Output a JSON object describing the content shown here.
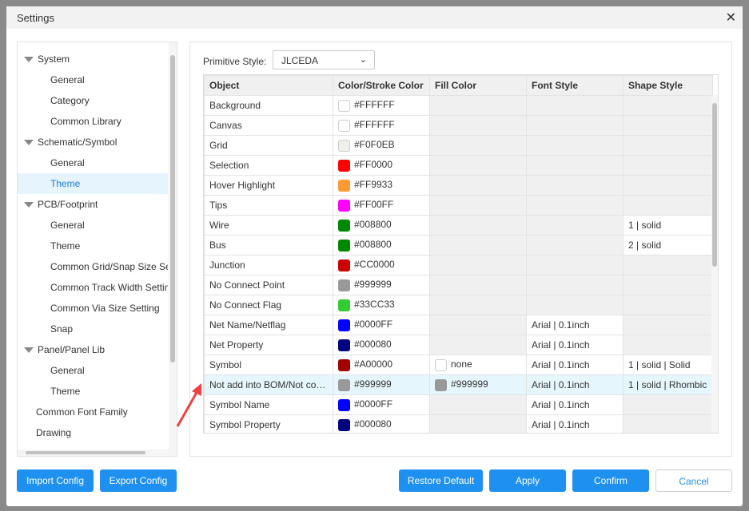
{
  "title": "Settings",
  "tree": [
    {
      "label": "System",
      "type": "g"
    },
    {
      "label": "General",
      "type": "c"
    },
    {
      "label": "Category",
      "type": "c"
    },
    {
      "label": "Common Library",
      "type": "c"
    },
    {
      "label": "Schematic/Symbol",
      "type": "g"
    },
    {
      "label": "General",
      "type": "c"
    },
    {
      "label": "Theme",
      "type": "c",
      "selected": true
    },
    {
      "label": "PCB/Footprint",
      "type": "g"
    },
    {
      "label": "General",
      "type": "c"
    },
    {
      "label": "Theme",
      "type": "c"
    },
    {
      "label": "Common Grid/Snap Size Setting",
      "type": "c"
    },
    {
      "label": "Common Track Width Setting",
      "type": "c"
    },
    {
      "label": "Common Via Size Setting",
      "type": "c"
    },
    {
      "label": "Snap",
      "type": "c"
    },
    {
      "label": "Panel/Panel Lib",
      "type": "g"
    },
    {
      "label": "General",
      "type": "c"
    },
    {
      "label": "Theme",
      "type": "c"
    },
    {
      "label": "Common Font Family",
      "type": "s"
    },
    {
      "label": "Drawing",
      "type": "s"
    }
  ],
  "primitive_style": {
    "label": "Primitive Style:",
    "value": "JLCEDA"
  },
  "columns": [
    "Object",
    "Color/Stroke Color",
    "Fill Color",
    "Font Style",
    "Shape Style"
  ],
  "rows": [
    {
      "object": "Background",
      "color": "#FFFFFF"
    },
    {
      "object": "Canvas",
      "color": "#FFFFFF"
    },
    {
      "object": "Grid",
      "color": "#F0F0EB"
    },
    {
      "object": "Selection",
      "color": "#FF0000"
    },
    {
      "object": "Hover Highlight",
      "color": "#FF9933"
    },
    {
      "object": "Tips",
      "color": "#FF00FF"
    },
    {
      "object": "Wire",
      "color": "#008800",
      "shape": "1 | solid"
    },
    {
      "object": "Bus",
      "color": "#008800",
      "shape": "2 | solid"
    },
    {
      "object": "Junction",
      "color": "#CC0000"
    },
    {
      "object": "No Connect Point",
      "color": "#999999"
    },
    {
      "object": "No Connect Flag",
      "color": "#33CC33"
    },
    {
      "object": "Net Name/Netflag",
      "color": "#0000FF",
      "font": "Arial | 0.1inch"
    },
    {
      "object": "Net Property",
      "color": "#000080",
      "font": "Arial | 0.1inch"
    },
    {
      "object": "Symbol",
      "color": "#A00000",
      "fill": "none",
      "font": "Arial | 0.1inch",
      "shape": "1 | solid | Solid"
    },
    {
      "object": "Not add into BOM/Not convert to PCB",
      "color": "#999999",
      "fill": "#999999",
      "font": "Arial | 0.1inch",
      "shape": "1 | solid | Rhombic",
      "highlighted": true
    },
    {
      "object": "Symbol Name",
      "color": "#0000FF",
      "font": "Arial | 0.1inch"
    },
    {
      "object": "Symbol Property",
      "color": "#000080",
      "font": "Arial | 0.1inch"
    }
  ],
  "buttons": {
    "import": "Import Config",
    "export": "Export Config",
    "restore": "Restore Default",
    "apply": "Apply",
    "confirm": "Confirm",
    "cancel": "Cancel"
  },
  "colors": {
    "accent": "#1E90F0",
    "selected_bg": "#E6F4FD",
    "annotation_arrow": "#F04040"
  }
}
